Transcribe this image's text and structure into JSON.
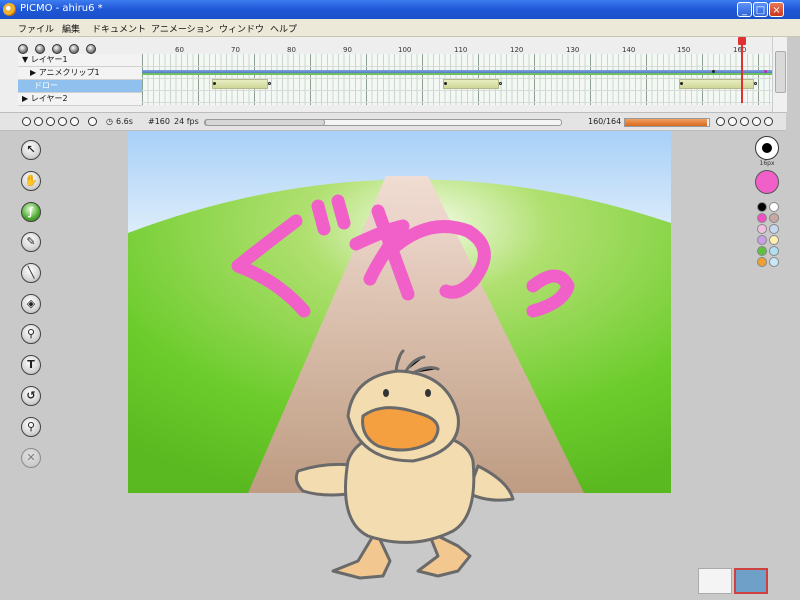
{
  "window": {
    "title": "PICMO - ahiru6 *",
    "minimize": "_",
    "maximize": "□",
    "close": "×"
  },
  "menu": [
    "ファイル",
    "編集",
    "ドキュメント",
    "アニメーション",
    "ウィンドウ",
    "ヘルプ"
  ],
  "timeline": {
    "ruler": [
      "60",
      "70",
      "80",
      "90",
      "100",
      "110",
      "120",
      "130",
      "140",
      "150",
      "160"
    ],
    "layers": [
      {
        "label": "▼ レイヤー1"
      },
      {
        "label": "▶ アニメクリップ1"
      },
      {
        "label": "ドロー"
      },
      {
        "label": "▶ レイヤー2"
      }
    ],
    "playhead_frame": 160
  },
  "status": {
    "time": "6.6s",
    "frame": "#160",
    "fps": "24 fps",
    "progress_text": "160/164",
    "progress_fraction": 0.975
  },
  "tools": [
    {
      "icon": "arrow-select-icon",
      "glyph": "↖"
    },
    {
      "icon": "hand-icon",
      "glyph": "✋"
    },
    {
      "icon": "brush-icon",
      "glyph": "∫"
    },
    {
      "icon": "pencil-icon",
      "glyph": "✎"
    },
    {
      "icon": "line-icon",
      "glyph": "╲"
    },
    {
      "icon": "bucket-icon",
      "glyph": "◈"
    },
    {
      "icon": "eyedropper-icon",
      "glyph": "⚲"
    },
    {
      "icon": "text-icon",
      "glyph": "T"
    },
    {
      "icon": "rotate-icon",
      "glyph": "↺"
    },
    {
      "icon": "zoom-icon",
      "glyph": "⚲"
    },
    {
      "icon": "disabled-tool-icon",
      "glyph": "✕"
    }
  ],
  "canvas": {
    "drawn_text": "ぐわっ"
  },
  "palette": {
    "brush_size": "16px",
    "current_color": "#f060c8",
    "swatches": [
      "#000000",
      "#ffffff",
      "#f050c0",
      "#c8a8a0",
      "#f0c0e0",
      "#c8d8f0",
      "#c8a0e8",
      "#fff0b0",
      "#60c040",
      "#b0e0f0",
      "#f0a030",
      "#c8e8f8"
    ]
  },
  "colors": {
    "sky_top": "#a8d0f8",
    "grass": "#6ccc2c",
    "path": "#d4a898",
    "duck_body": "#f2dcb0",
    "duck_beak": "#f5a040",
    "pink_text": "#f060c8"
  }
}
